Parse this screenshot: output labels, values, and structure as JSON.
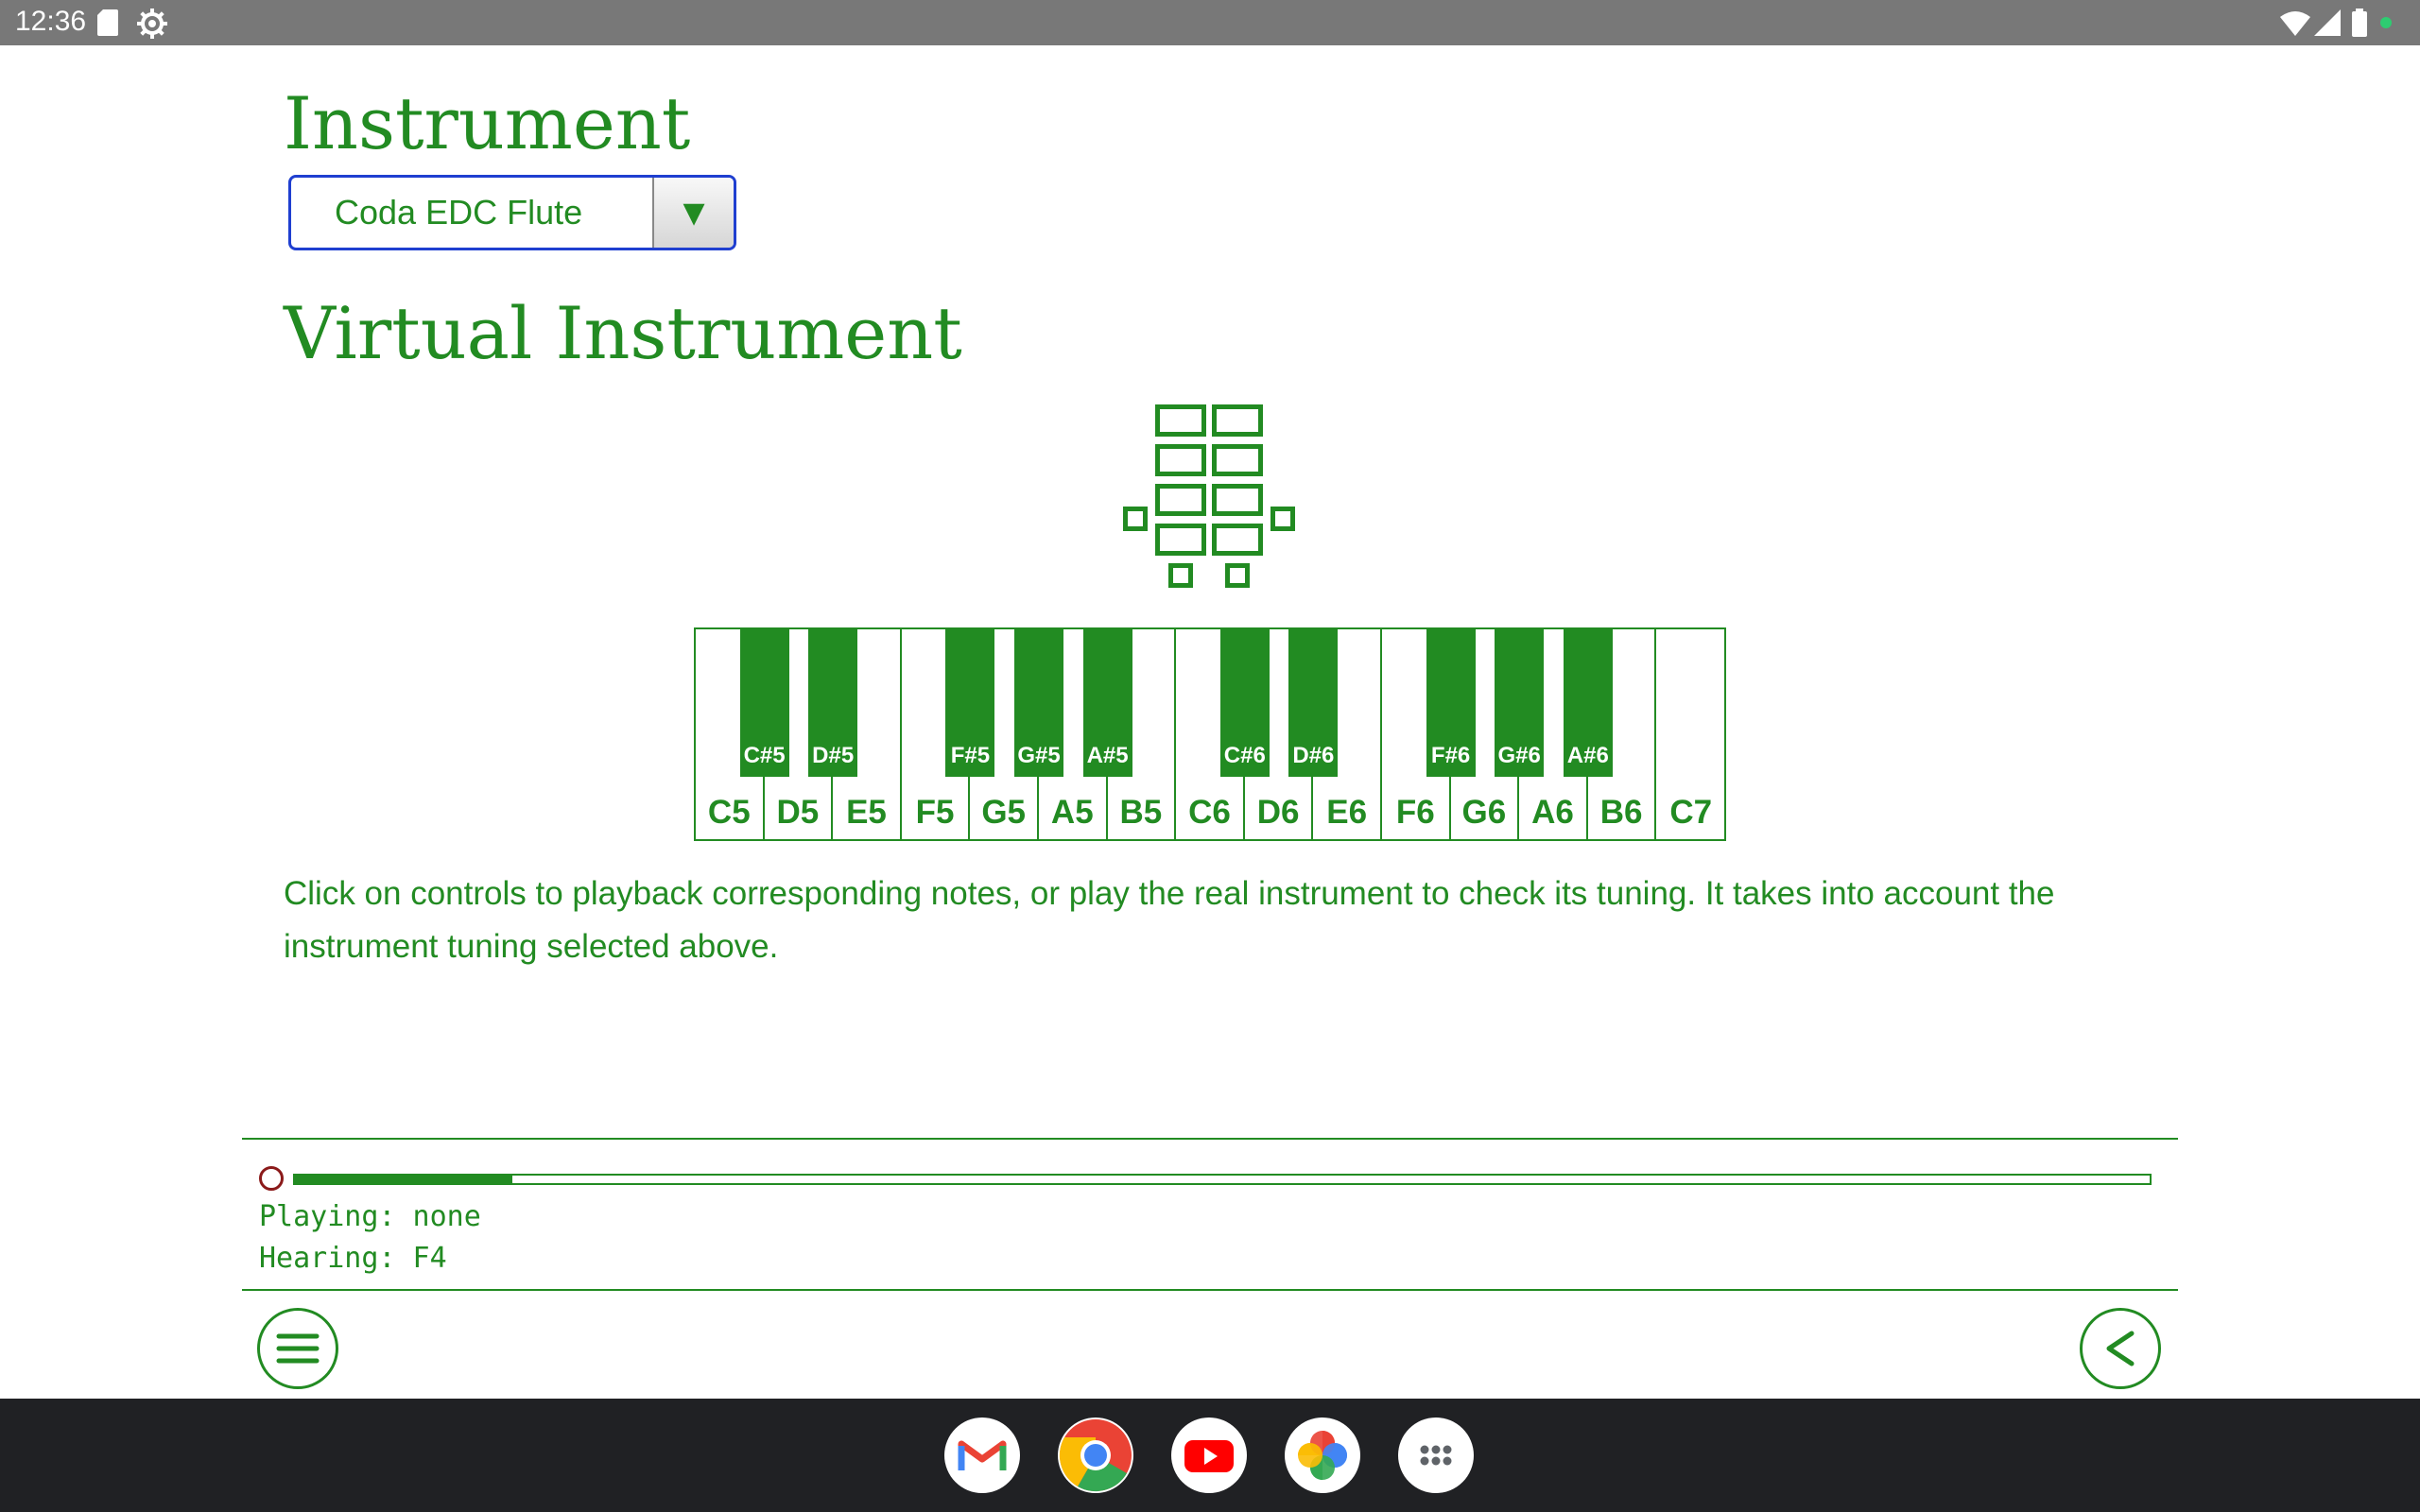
{
  "status_bar": {
    "time": "12:36",
    "icons": [
      "sd-card-icon",
      "settings-gear-icon",
      "wifi-icon",
      "signal-icon",
      "battery-icon",
      "notification-dot-icon"
    ]
  },
  "instrument_section": {
    "title": "Instrument",
    "selected": "Coda EDC Flute",
    "dropdown_arrow": "▼"
  },
  "virtual_section": {
    "title": "Virtual Instrument"
  },
  "keyboard": {
    "white_keys": [
      "C5",
      "D5",
      "E5",
      "F5",
      "G5",
      "A5",
      "B5",
      "C6",
      "D6",
      "E6",
      "F6",
      "G6",
      "A6",
      "B6",
      "C7"
    ],
    "black_keys": [
      {
        "label": "C#5",
        "after": 0
      },
      {
        "label": "D#5",
        "after": 1
      },
      {
        "label": "F#5",
        "after": 3
      },
      {
        "label": "G#5",
        "after": 4
      },
      {
        "label": "A#5",
        "after": 5
      },
      {
        "label": "C#6",
        "after": 7
      },
      {
        "label": "D#6",
        "after": 8
      },
      {
        "label": "F#6",
        "after": 10
      },
      {
        "label": "G#6",
        "after": 11
      },
      {
        "label": "A#6",
        "after": 12
      }
    ]
  },
  "description": "Click on controls to playback corresponding notes, or play the real instrument to check its tuning. It takes into account the instrument tuning selected above.",
  "player": {
    "level_fraction": 0.117,
    "playing": "Playing: none",
    "hearing": "Hearing: F4"
  },
  "taskbar": {
    "apps": [
      "gmail-icon",
      "chrome-icon",
      "youtube-icon",
      "photos-icon",
      "app-launcher-icon"
    ]
  },
  "colors": {
    "accent": "#228b22",
    "select_border": "#1f3fd0",
    "record": "#8b1a1a",
    "status_bar": "#787878",
    "taskbar": "#202124"
  }
}
